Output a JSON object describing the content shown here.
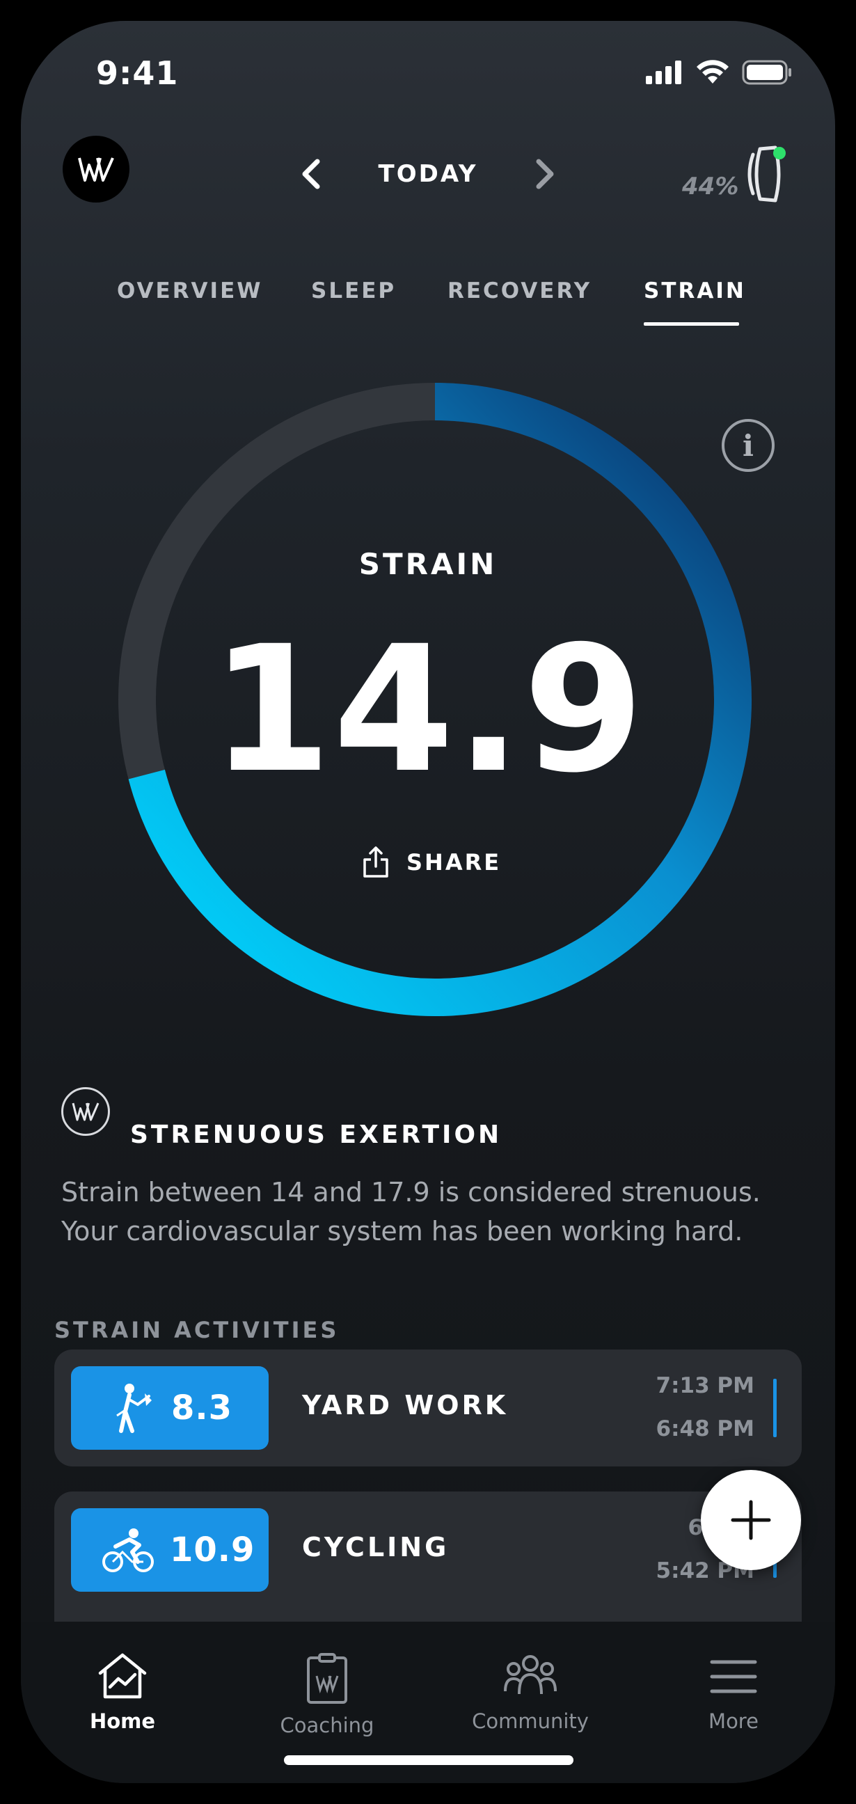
{
  "status_bar": {
    "time": "9:41"
  },
  "header": {
    "day_label": "TODAY",
    "battery_percent": "44%"
  },
  "tabs": [
    {
      "label": "OVERVIEW",
      "active": false
    },
    {
      "label": "SLEEP",
      "active": false
    },
    {
      "label": "RECOVERY",
      "active": false
    },
    {
      "label": "STRAIN",
      "active": true
    }
  ],
  "strain": {
    "title": "STRAIN",
    "value": "14.9",
    "max_value": 21,
    "share_label": "SHARE"
  },
  "exertion": {
    "title": "STRENUOUS EXERTION",
    "description": "Strain between 14 and 17.9 is considered strenuous. Your cardiovascular system has been working hard."
  },
  "activities": {
    "section_label": "STRAIN ACTIVITIES",
    "items": [
      {
        "icon": "yard-work-icon",
        "value": "8.3",
        "name": "YARD WORK",
        "end_time": "7:13 PM",
        "start_time": "6:48 PM"
      },
      {
        "icon": "cycling-icon",
        "value": "10.9",
        "name": "CYCLING",
        "end_time": "6:4",
        "start_time": "5:42 PM"
      }
    ]
  },
  "tab_bar": [
    {
      "label": "Home",
      "icon": "home-icon",
      "active": true
    },
    {
      "label": "Coaching",
      "icon": "coaching-icon",
      "active": false
    },
    {
      "label": "Community",
      "icon": "community-icon",
      "active": false
    },
    {
      "label": "More",
      "icon": "menu-icon",
      "active": false
    }
  ],
  "colors": {
    "accent": "#1a93e6",
    "ring_track": "#33373d",
    "ring_start": "#00d9ff",
    "ring_end": "#0a2c63",
    "sync_dot": "#2ee06b"
  }
}
